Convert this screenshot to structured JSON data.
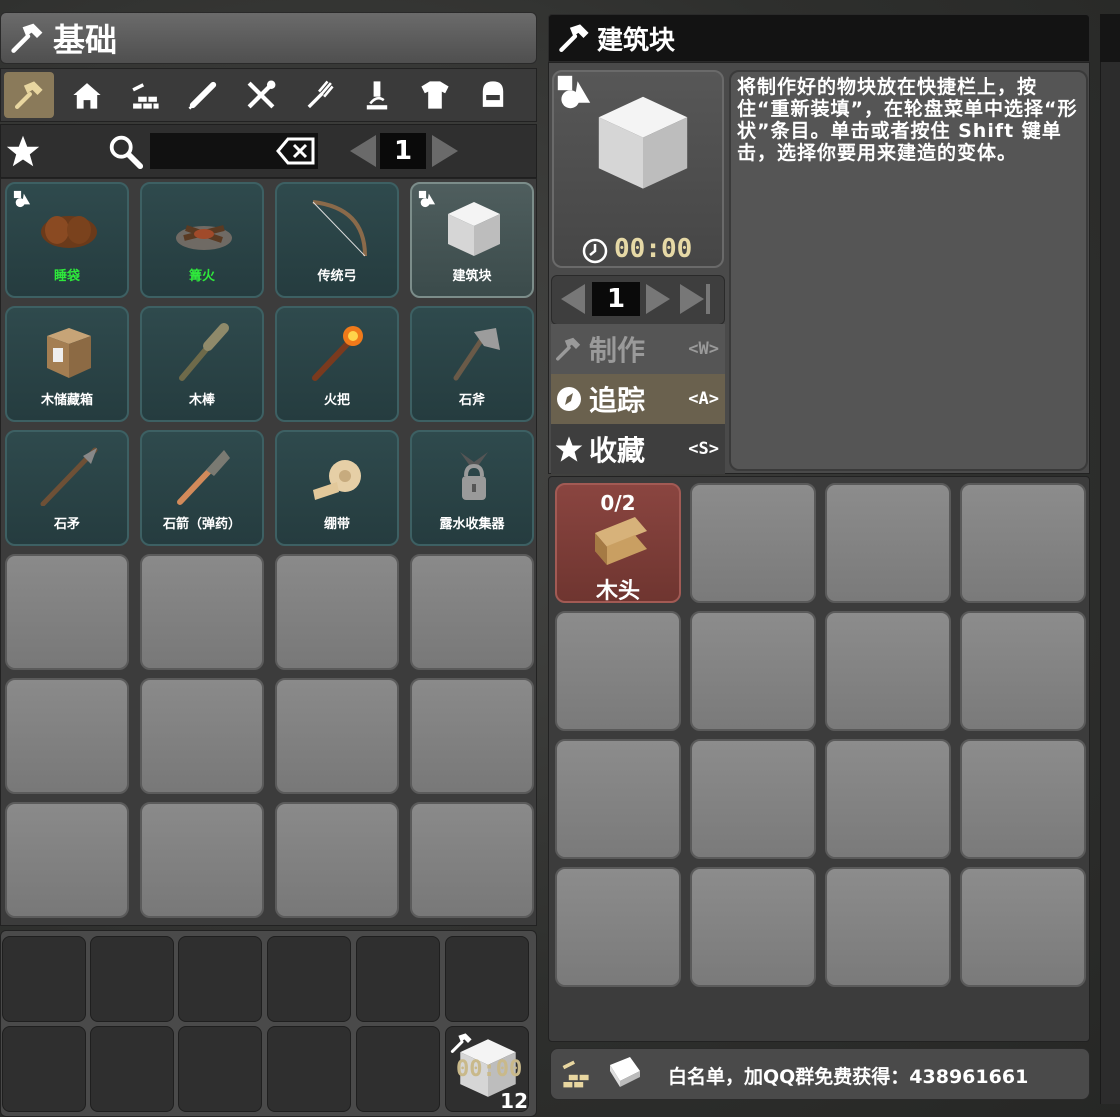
{
  "left_panel": {
    "title": "基础",
    "categories": [
      {
        "icon": "hammer-icon",
        "active": true
      },
      {
        "icon": "house-icon"
      },
      {
        "icon": "building-icon"
      },
      {
        "icon": "medical-icon"
      },
      {
        "icon": "tools-icon"
      },
      {
        "icon": "fork-icon"
      },
      {
        "icon": "science-icon"
      },
      {
        "icon": "shirt-icon"
      },
      {
        "icon": "chair-icon"
      }
    ],
    "search": {
      "value": "",
      "placeholder": ""
    },
    "page": "1",
    "recipes": [
      {
        "label": "睡袋",
        "green": true,
        "icon": "sleeping-bag-icon"
      },
      {
        "label": "篝火",
        "green": true,
        "icon": "campfire-icon"
      },
      {
        "label": "传统弓",
        "green": false,
        "icon": "bow-icon"
      },
      {
        "label": "建筑块",
        "green": false,
        "icon": "building-block-icon",
        "selected": true
      },
      {
        "label": "木储藏箱",
        "green": false,
        "icon": "wood-box-icon"
      },
      {
        "label": "木棒",
        "green": false,
        "icon": "club-icon"
      },
      {
        "label": "火把",
        "green": false,
        "icon": "torch-icon"
      },
      {
        "label": "石斧",
        "green": false,
        "icon": "stone-axe-icon"
      },
      {
        "label": "石矛",
        "green": false,
        "icon": "stone-spear-icon"
      },
      {
        "label": "石箭（弹药）",
        "green": false,
        "icon": "stone-arrow-icon"
      },
      {
        "label": "绷带",
        "green": false,
        "icon": "bandage-icon"
      },
      {
        "label": "露水收集器",
        "green": false,
        "icon": "dew-collector-icon"
      }
    ]
  },
  "toolbelt": {
    "queued_timer": "00:00",
    "queued_count": "12"
  },
  "right_panel": {
    "title": "建筑块",
    "craft_time": "00:00",
    "description": "将制作好的物块放在快捷栏上，按住“重新装填”，在轮盘菜单中选择“形状”条目。单击或者按住 Shift 键单击，选择你要用来建造的变体。",
    "quantity": "1",
    "menu": [
      {
        "label": "制作",
        "key": "<W>",
        "icon": "hammer-icon",
        "active": false
      },
      {
        "label": "追踪",
        "key": "<A>",
        "icon": "compass-icon",
        "active": true
      },
      {
        "label": "收藏",
        "key": "<S>",
        "icon": "star-icon",
        "active": true
      }
    ],
    "ingredients": [
      {
        "name": "木头",
        "count": "0/2",
        "icon": "wood-plank-icon"
      }
    ],
    "footer": "白名单，加QQ群免费获得：438961661"
  },
  "colors": {
    "green_label": "#2ee83b",
    "timer_gold": "#e6d9a6",
    "ingredient_missing": "#7a3b36"
  }
}
